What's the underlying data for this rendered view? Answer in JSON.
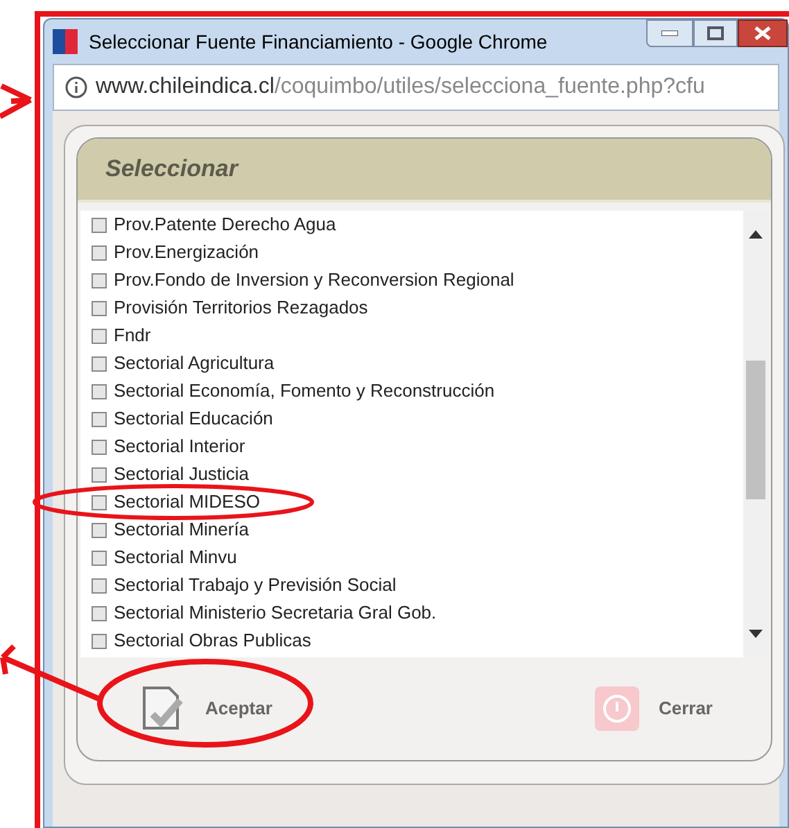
{
  "window": {
    "title": "Seleccionar Fuente Financiamiento - Google Chrome"
  },
  "address_bar": {
    "domain": "www.chileindica.cl",
    "path": "/coquimbo/utiles/selecciona_fuente.php?cfu"
  },
  "panel": {
    "title": "Seleccionar"
  },
  "items": [
    {
      "label": "Prov.Patente Derecho Agua",
      "checked": false
    },
    {
      "label": "Prov.Energización",
      "checked": false
    },
    {
      "label": "Prov.Fondo de Inversion y Reconversion Regional",
      "checked": false
    },
    {
      "label": "Provisión Territorios Rezagados",
      "checked": false
    },
    {
      "label": "Fndr",
      "checked": false
    },
    {
      "label": "Sectorial Agricultura",
      "checked": false
    },
    {
      "label": "Sectorial Economía, Fomento y Reconstrucción",
      "checked": false
    },
    {
      "label": "Sectorial Educación",
      "checked": false
    },
    {
      "label": "Sectorial Interior",
      "checked": false
    },
    {
      "label": "Sectorial Justicia",
      "checked": false
    },
    {
      "label": "Sectorial MIDESO",
      "checked": false
    },
    {
      "label": "Sectorial Minería",
      "checked": false
    },
    {
      "label": "Sectorial Minvu",
      "checked": false
    },
    {
      "label": "Sectorial Trabajo y Previsión Social",
      "checked": false
    },
    {
      "label": "Sectorial Ministerio Secretaria Gral Gob.",
      "checked": false
    },
    {
      "label": "Sectorial Obras Publicas",
      "checked": false
    }
  ],
  "buttons": [
    {
      "label": "Aceptar",
      "kind": "accept"
    },
    {
      "label": "Cerrar",
      "kind": "close"
    }
  ]
}
